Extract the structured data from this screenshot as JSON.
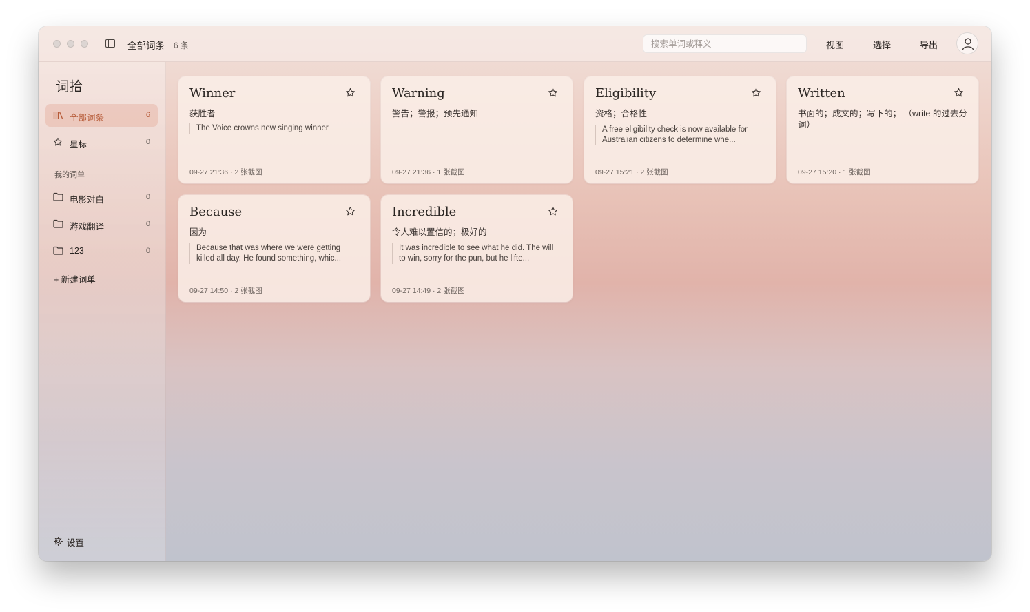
{
  "window": {
    "title": "全部词条",
    "count_label": "6 条"
  },
  "toolbar": {
    "search_placeholder": "搜索单词或释义",
    "view_label": "视图",
    "select_label": "选择",
    "export_label": "导出"
  },
  "sidebar": {
    "app_name": "词拾",
    "items": [
      {
        "label": "全部词条",
        "count": "6",
        "icon": "library-icon",
        "active": true
      },
      {
        "label": "星标",
        "count": "0",
        "icon": "star-icon",
        "active": false
      }
    ],
    "section_title": "我的词单",
    "lists": [
      {
        "label": "电影对白",
        "count": "0",
        "icon": "folder-icon"
      },
      {
        "label": "游戏翻译",
        "count": "0",
        "icon": "folder-icon"
      },
      {
        "label": "123",
        "count": "0",
        "icon": "folder-icon"
      }
    ],
    "new_list_label": "+ 新建词单",
    "settings_label": "设置"
  },
  "cards": [
    {
      "word": "Winner",
      "definition": "获胜者",
      "example": "The Voice crowns new singing winner",
      "meta": "09-27 21:36 · 2 张截图"
    },
    {
      "word": "Warning",
      "definition": "警告；警报；预先通知",
      "example": "",
      "meta": "09-27 21:36 · 1 张截图"
    },
    {
      "word": "Eligibility",
      "definition": "资格；合格性",
      "example": "A free eligibility check is now available for Australian citizens to determine whe...",
      "meta": "09-27 15:21 · 2 张截图"
    },
    {
      "word": "Written",
      "definition": "书面的；成文的；写下的； （write 的过去分词）",
      "example": "",
      "meta": "09-27 15:20 · 1 张截图"
    },
    {
      "word": "Because",
      "definition": "因为",
      "example": "Because that was where we were getting killed all day. He found something, whic...",
      "meta": "09-27 14:50 · 2 张截图"
    },
    {
      "word": "Incredible",
      "definition": "令人难以置信的；极好的",
      "example": "It was incredible to see what he did. The will to win, sorry for the pun, but he lifte...",
      "meta": "09-27 14:49 · 2 张截图"
    }
  ]
}
